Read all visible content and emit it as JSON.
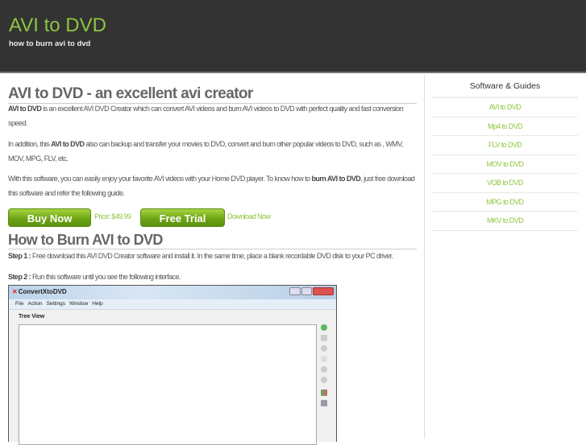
{
  "header": {
    "title": "AVI to DVD",
    "tagline": "how to burn avi to dvd"
  },
  "main": {
    "heading": "AVI to DVD - an excellent avi creator",
    "p1": {
      "bold": "AVI to DVD",
      "text": " is an excellent AVI DVD Creator which can convert AVI videos and burn AVI videos to DVD with perfect quality and fast conversion speed."
    },
    "p2": {
      "pre": "In addition, this ",
      "bold": "AVI to DVD",
      "text": " also can backup and transfer your movies to DVD, convert and burn other popular videos to DVD, such as , WMV, MOV, MPG, FLV, etc."
    },
    "p3": {
      "pre": "With this software, you can easily enjoy your favorite AVI videos with your Home DVD player. To know how to ",
      "bold": "burn AVI to DVD",
      "text": ", just free download this software and refer the following guide."
    },
    "buy_label": "Buy Now",
    "price": "Price: $49.99",
    "trial_label": "Free Trial",
    "download": "Download Now",
    "heading2": "How to Burn AVI to DVD",
    "step1": {
      "label": "Step 1 :",
      "text": " Free download this AVI DVD Creator software and install it. In the same time, place a blank recordable DVD disk to your PC driver."
    },
    "step2": {
      "label": "Step 2 :",
      "text": " Run this software until you see the following interface."
    },
    "app": {
      "title": "ConvertXtoDVD",
      "menu": [
        "File",
        "Action",
        "Settings",
        "Window",
        "Help"
      ],
      "tree_label": "Tree View"
    }
  },
  "sidebar": {
    "title": "Software & Guides",
    "items": [
      "AVI to DVD",
      "Mp4 to DVD",
      "FLV to DVD",
      "MOV to DVD",
      "VOB to DVD",
      "MPG to DVD",
      "MKV to DVD"
    ]
  }
}
